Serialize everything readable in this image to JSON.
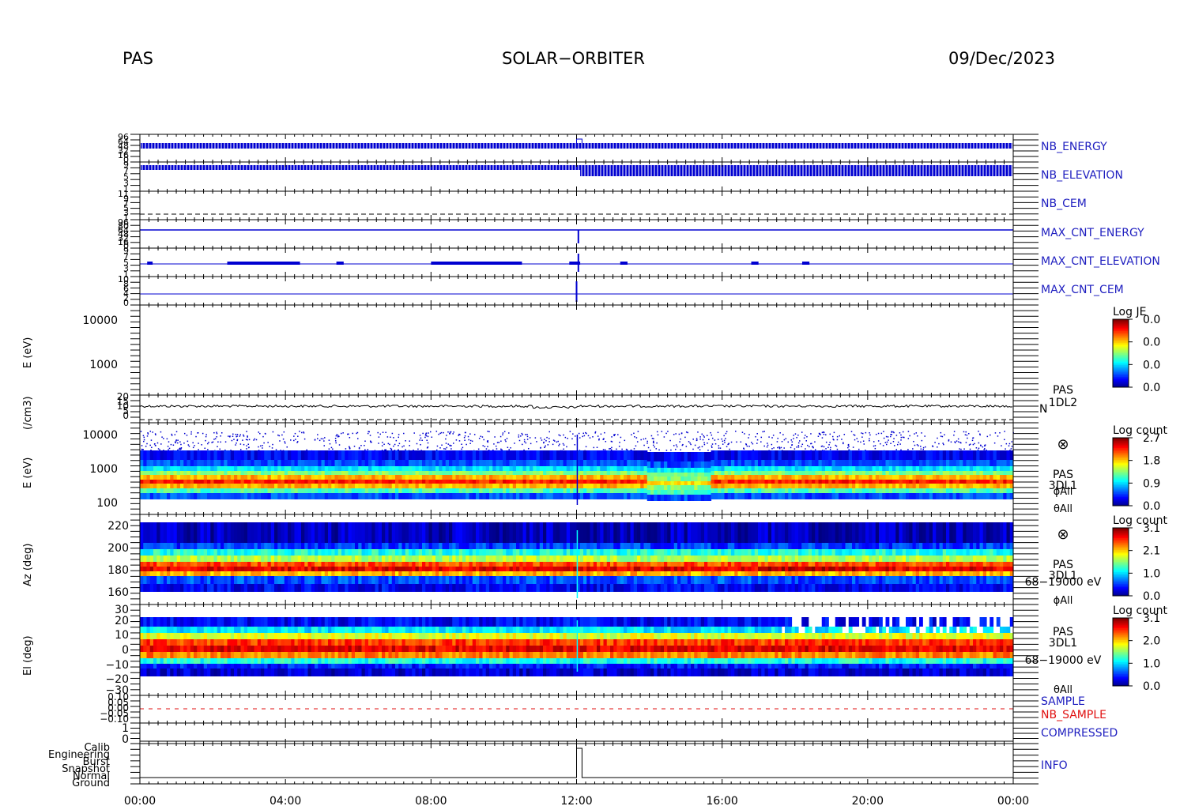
{
  "header": {
    "left": "PAS",
    "center": "SOLAR−ORBITER",
    "right": "09/Dec/2023"
  },
  "colors": {
    "trace": "#0000d0",
    "label_blue": "#2020c0",
    "label_red": "#e01010"
  },
  "chart_data": {
    "type": "heatmap",
    "x_ticks": [
      "00:00",
      "04:00",
      "08:00",
      "12:00",
      "16:00",
      "20:00",
      "00:00"
    ],
    "x_range_hours": [
      0,
      24
    ],
    "panels": [
      {
        "name": "NB_ENERGY",
        "side_label": "NB_ENERGY",
        "yticks": [
          "96",
          "64",
          "48",
          "32",
          "16",
          "0"
        ]
      },
      {
        "name": "NB_ELEVATION",
        "side_label": "NB_ELEVATION",
        "yticks": [
          "9",
          "7",
          "5",
          "3",
          "1"
        ]
      },
      {
        "name": "NB_CEM",
        "side_label": "NB_CEM",
        "yticks": [
          "11",
          "9",
          "7",
          "5",
          "3",
          "1"
        ]
      },
      {
        "name": "MAX_CNT_ENERGY",
        "side_label": "MAX_CNT_ENERGY",
        "yticks": [
          "96",
          "80",
          "64",
          "48",
          "32",
          "16",
          "0"
        ]
      },
      {
        "name": "MAX_CNT_ELEVATION",
        "side_label": "MAX_CNT_ELEVATION",
        "yticks": [
          "9",
          "7",
          "5",
          "3",
          "1"
        ]
      },
      {
        "name": "MAX_CNT_CEM",
        "side_label": "MAX_CNT_CEM",
        "yticks": [
          "10",
          "8",
          "6",
          "4",
          "2",
          "0"
        ]
      },
      {
        "name": "energy-empty",
        "ylabel": "E (eV)",
        "yticks": [
          "10000",
          "1000"
        ],
        "colorbar": {
          "title": "Log JE",
          "ticks": [
            "0.0",
            "0.0",
            "0.0",
            "0.0"
          ]
        }
      },
      {
        "name": "density",
        "ylabel": "(/cm3)",
        "yticks": [
          "20",
          "15",
          "10",
          "5",
          "0"
        ],
        "side_label": [
          "PAS",
          "1DL2",
          "N"
        ]
      },
      {
        "name": "energy-spectrogram",
        "ylabel": "E (eV)",
        "yticks": [
          "10000",
          "1000",
          "100"
        ],
        "side_label": [
          "⊗",
          "PAS",
          "3DL1",
          "ϕAll",
          "θAll"
        ],
        "colorbar": {
          "title": "Log count",
          "ticks": [
            "2.7",
            "1.8",
            "0.9",
            "0.0"
          ]
        }
      },
      {
        "name": "azimuth-spectrogram",
        "ylabel": "Az (deg)",
        "yticks": [
          "220",
          "200",
          "180",
          "160"
        ],
        "side_label": [
          "⊗",
          "PAS",
          "3DL1",
          "68−19000 eV",
          "ϕAll"
        ],
        "colorbar": {
          "title": "Log count",
          "ticks": [
            "3.1",
            "2.1",
            "1.0",
            "0.0"
          ]
        }
      },
      {
        "name": "elevation-spectrogram",
        "ylabel": "El (deg)",
        "yticks": [
          "30",
          "20",
          "10",
          "0",
          "−10",
          "−20",
          "−30"
        ],
        "side_label": [
          "PAS",
          "3DL1",
          "68−19000 eV",
          "θAll"
        ],
        "colorbar": {
          "title": "Log count",
          "ticks": [
            "3.1",
            "2.0",
            "1.0",
            "0.0"
          ]
        }
      },
      {
        "name": "sample",
        "yticks": [
          "0.10",
          "0.05",
          "0.00",
          "−0.05",
          "−0.10"
        ],
        "side_label": [
          "SAMPLE",
          "NB_SAMPLE"
        ]
      },
      {
        "name": "compressed",
        "yticks": [
          "1",
          "0"
        ],
        "side_label": [
          "COMPRESSED"
        ]
      },
      {
        "name": "info",
        "yticks": [
          "Calib",
          "Engineering",
          "Burst",
          "Snapshot",
          "Normal",
          "Ground"
        ],
        "side_label": [
          "INFO"
        ]
      }
    ]
  }
}
